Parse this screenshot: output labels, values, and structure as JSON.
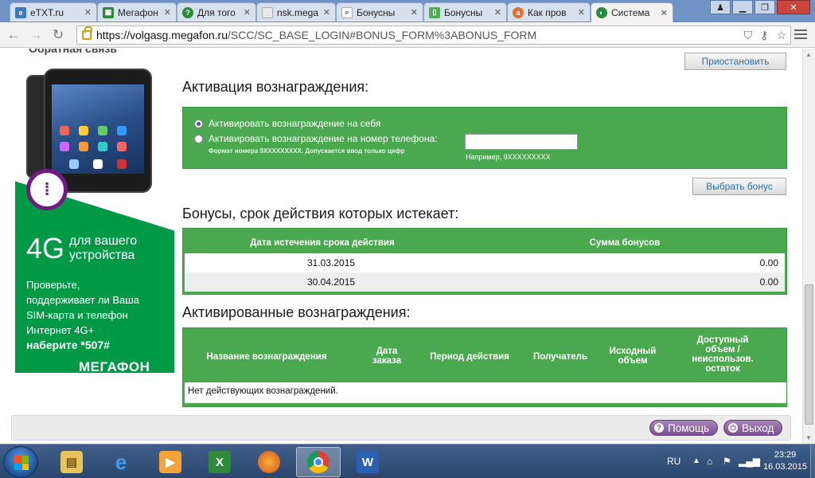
{
  "browser": {
    "tabs": [
      {
        "label": "eTXT.ru",
        "fav_color": "#3b78c4",
        "fav_icon": "e-icon"
      },
      {
        "label": "Мегафон",
        "fav_color": "#2e8b3a",
        "fav_icon": "sheet-icon"
      },
      {
        "label": "Для того",
        "fav_color": "#2e8b3a",
        "fav_icon": "question-icon"
      },
      {
        "label": "nsk.mega",
        "fav_color": "#b0b0b0",
        "fav_icon": "page-icon"
      },
      {
        "label": "Бонусны",
        "fav_color": "#ffffff",
        "fav_icon": "search-icon"
      },
      {
        "label": "Бонусны",
        "fav_color": "#4caf50",
        "fav_icon": "phone-icon"
      },
      {
        "label": "Как пров",
        "fav_color": "#e0702c",
        "fav_icon": "bird-icon"
      },
      {
        "label": "Система",
        "fav_color": "#2a8a3e",
        "fav_icon": "megafon-icon"
      }
    ],
    "url_host": "https://volgasg.megafon.ru",
    "url_path": "/SCC/SC_BASE_LOGIN#BONUS_FORM%3ABONUS_FORM"
  },
  "page": {
    "cut_heading": "Обратная связь",
    "suspend_button": "Приостановить",
    "activation": {
      "title": "Активация вознаграждения:",
      "option_self": "Активировать вознаграждение на себя",
      "option_phone": "Активировать вознаграждение на номер телефона:",
      "phone_hint": "Формат номера 9XXXXXXXXX. Допускается ввод только цифр",
      "example": "Например, 9XXXXXXXXX",
      "select_button": "Выбрать бонус"
    },
    "expiring": {
      "title": "Бонусы, срок действия которых истекает:",
      "columns": [
        "Дата истечения срока действия",
        "Сумма бонусов"
      ],
      "rows": [
        {
          "date": "31.03.2015",
          "amount": "0.00"
        },
        {
          "date": "30.04.2015",
          "amount": "0.00"
        }
      ]
    },
    "activated": {
      "title": "Активированные вознаграждения:",
      "columns": [
        "Название вознаграждения",
        "Дата заказа",
        "Период действия",
        "Получатель",
        "Исходный объем",
        "Доступный объем / неиспользов. остаток"
      ],
      "empty": "Нет действующих вознаграждений."
    },
    "help_button": "Помощь",
    "exit_button": "Выход"
  },
  "banner": {
    "big": "4G",
    "small": "для вашего устройства",
    "line1": "Проверьте,",
    "line2": "поддерживает ли Ваша",
    "line3": "SIM-карта и телефон",
    "line4": "Интернет 4G+",
    "dial": "наберите *507#",
    "brand": "МЕГАФОН"
  },
  "taskbar": {
    "lang": "RU",
    "time": "23:29",
    "date": "16.03.2015"
  }
}
